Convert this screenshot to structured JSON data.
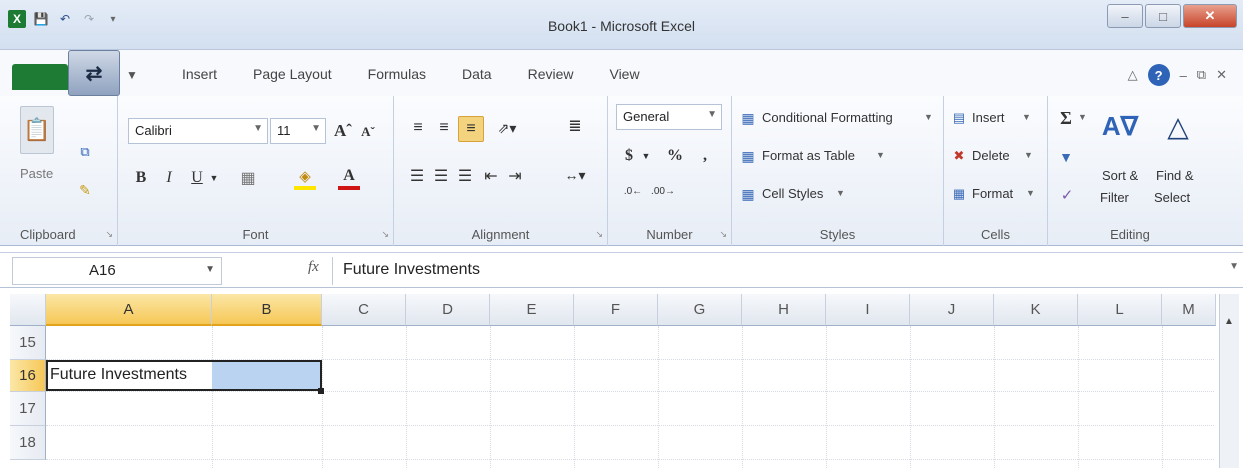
{
  "window": {
    "title": "Book1 - Microsoft Excel"
  },
  "tabs": [
    {
      "label": "Insert"
    },
    {
      "label": "Page Layout"
    },
    {
      "label": "Formulas"
    },
    {
      "label": "Data"
    },
    {
      "label": "Review"
    },
    {
      "label": "View"
    }
  ],
  "ribbon": {
    "clipboard": {
      "label": "Clipboard",
      "paste": "Paste"
    },
    "font": {
      "label": "Font",
      "name": "Calibri",
      "size": "11",
      "bold": "B",
      "italic": "I",
      "underline": "U"
    },
    "alignment": {
      "label": "Alignment"
    },
    "number": {
      "label": "Number",
      "format": "General",
      "currency": "$",
      "percent": "%",
      "comma": ","
    },
    "styles": {
      "label": "Styles",
      "conditional": "Conditional Formatting",
      "format_table": "Format as Table",
      "cell_styles": "Cell Styles"
    },
    "cells": {
      "label": "Cells",
      "insert": "Insert",
      "delete": "Delete",
      "format": "Format"
    },
    "editing": {
      "label": "Editing",
      "sort_filter_1": "Sort &",
      "sort_filter_2": "Filter",
      "find_select_1": "Find &",
      "find_select_2": "Select",
      "sigma": "Σ"
    }
  },
  "formula_bar": {
    "name_box": "A16",
    "fx": "fx",
    "content": "Future Investments"
  },
  "grid": {
    "columns": [
      "A",
      "B",
      "C",
      "D",
      "E",
      "F",
      "G",
      "H",
      "I",
      "J",
      "K",
      "L",
      "M"
    ],
    "rows": [
      "15",
      "16",
      "17",
      "18"
    ],
    "active_cell_text": "Future Investments"
  },
  "colors": {
    "excel_green": "#1e7b34",
    "selection_header": "#f6c757",
    "selection_fill": "#b9d3f0"
  }
}
